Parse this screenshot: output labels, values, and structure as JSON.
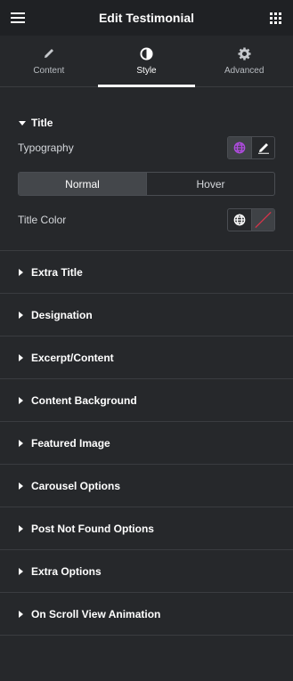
{
  "header": {
    "title": "Edit Testimonial",
    "menu_icon": "hamburger-icon",
    "apps_icon": "grid-icon"
  },
  "tabs": [
    {
      "label": "Content",
      "icon": "pencil-icon"
    },
    {
      "label": "Style",
      "icon": "half-circle-icon",
      "active": true
    },
    {
      "label": "Advanced",
      "icon": "gear-icon"
    }
  ],
  "title_section": {
    "heading": "Title",
    "typography_label": "Typography",
    "state_options": [
      "Normal",
      "Hover"
    ],
    "active_state": "Normal",
    "color_label": "Title Color"
  },
  "sections": [
    "Extra Title",
    "Designation",
    "Excerpt/Content",
    "Content Background",
    "Featured Image",
    "Carousel Options",
    "Post Not Found Options",
    "Extra Options",
    "On Scroll View Animation"
  ],
  "colors": {
    "globe_active": "#b04be0",
    "accent": "#ffffff",
    "clear_line": "#d0354a"
  }
}
